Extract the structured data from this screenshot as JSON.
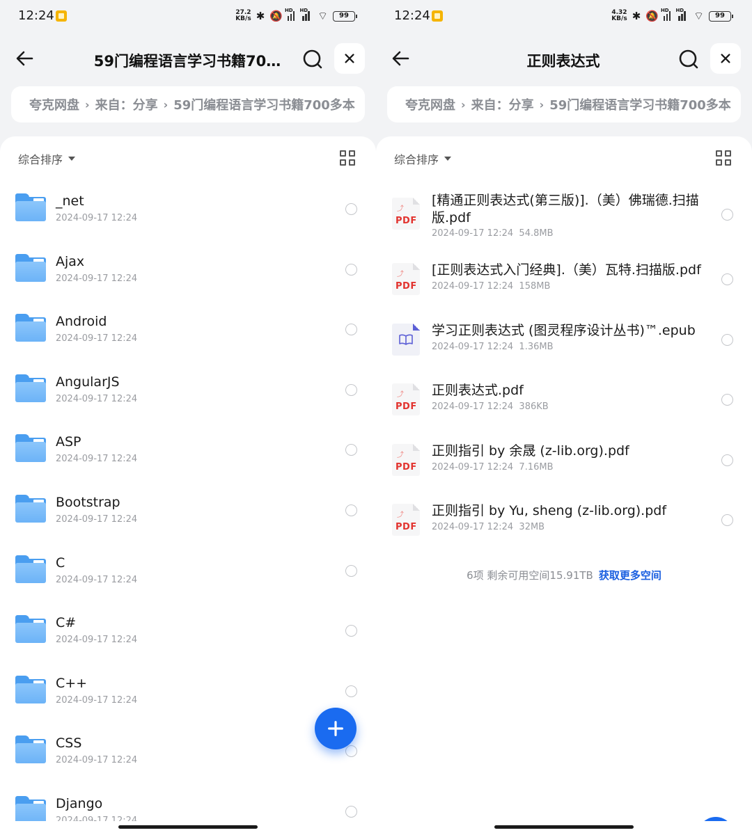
{
  "status_bar": {
    "time": "12:24",
    "left_speed_top": "27.2",
    "left_speed_bottom": "KB/s",
    "right_speed_top": "4.32",
    "right_speed_bottom": "KB/s",
    "hd_label": "HD",
    "battery": "99"
  },
  "left": {
    "title": "59门编程语言学习书籍70…",
    "breadcrumb": [
      "夸克网盘",
      "来自：分享",
      "59门编程语言学习书籍700多本"
    ],
    "sort_label": "综合排序",
    "items": [
      {
        "name": "_net",
        "date": "2024-09-17 12:24"
      },
      {
        "name": "Ajax",
        "date": "2024-09-17 12:24"
      },
      {
        "name": "Android",
        "date": "2024-09-17 12:24"
      },
      {
        "name": "AngularJS",
        "date": "2024-09-17 12:24"
      },
      {
        "name": "ASP",
        "date": "2024-09-17 12:24"
      },
      {
        "name": "Bootstrap",
        "date": "2024-09-17 12:24"
      },
      {
        "name": "C",
        "date": "2024-09-17 12:24"
      },
      {
        "name": "C#",
        "date": "2024-09-17 12:24"
      },
      {
        "name": "C++",
        "date": "2024-09-17 12:24"
      },
      {
        "name": "CSS",
        "date": "2024-09-17 12:24"
      },
      {
        "name": "Django",
        "date": "2024-09-17 12:24"
      }
    ],
    "fab_label": "+"
  },
  "right": {
    "title": "正则表达式",
    "breadcrumb": [
      "夸克网盘",
      "来自：分享",
      "59门编程语言学习书籍700多本"
    ],
    "sort_label": "综合排序",
    "files": [
      {
        "name": "[精通正则表达式(第三版)].（美）佛瑞德.扫描版.pdf",
        "date": "2024-09-17 12:24",
        "size": "54.8MB",
        "type": "pdf"
      },
      {
        "name": "[正则表达式入门经典].（美）瓦特.扫描版.pdf",
        "date": "2024-09-17 12:24",
        "size": "158MB",
        "type": "pdf"
      },
      {
        "name": "学习正则表达式 (图灵程序设计丛书)™.epub",
        "date": "2024-09-17 12:24",
        "size": "1.36MB",
        "type": "epub"
      },
      {
        "name": "正则表达式.pdf",
        "date": "2024-09-17 12:24",
        "size": "386KB",
        "type": "pdf"
      },
      {
        "name": "正则指引 by 余晟 (z-lib.org).pdf",
        "date": "2024-09-17 12:24",
        "size": "7.16MB",
        "type": "pdf"
      },
      {
        "name": "正则指引 by Yu, sheng (z-lib.org).pdf",
        "date": "2024-09-17 12:24",
        "size": "32MB",
        "type": "pdf"
      }
    ],
    "pdf_badge": "PDF",
    "footer_count": "6项 剩余可用空间15.91TB",
    "footer_link": "获取更多空间"
  },
  "colors": {
    "accent": "#1a6bf0",
    "link": "#1a5fe0",
    "folder": "#6cb3f7",
    "pdf_red": "#e2332f",
    "epub_purple": "#5c5fd6"
  },
  "icons": {
    "back": "arrow-left-icon",
    "search": "search-icon",
    "close": "close-icon",
    "grid": "grid-view-icon",
    "folder": "folder-icon",
    "pdf": "pdf-file-icon",
    "epub": "book-icon"
  }
}
